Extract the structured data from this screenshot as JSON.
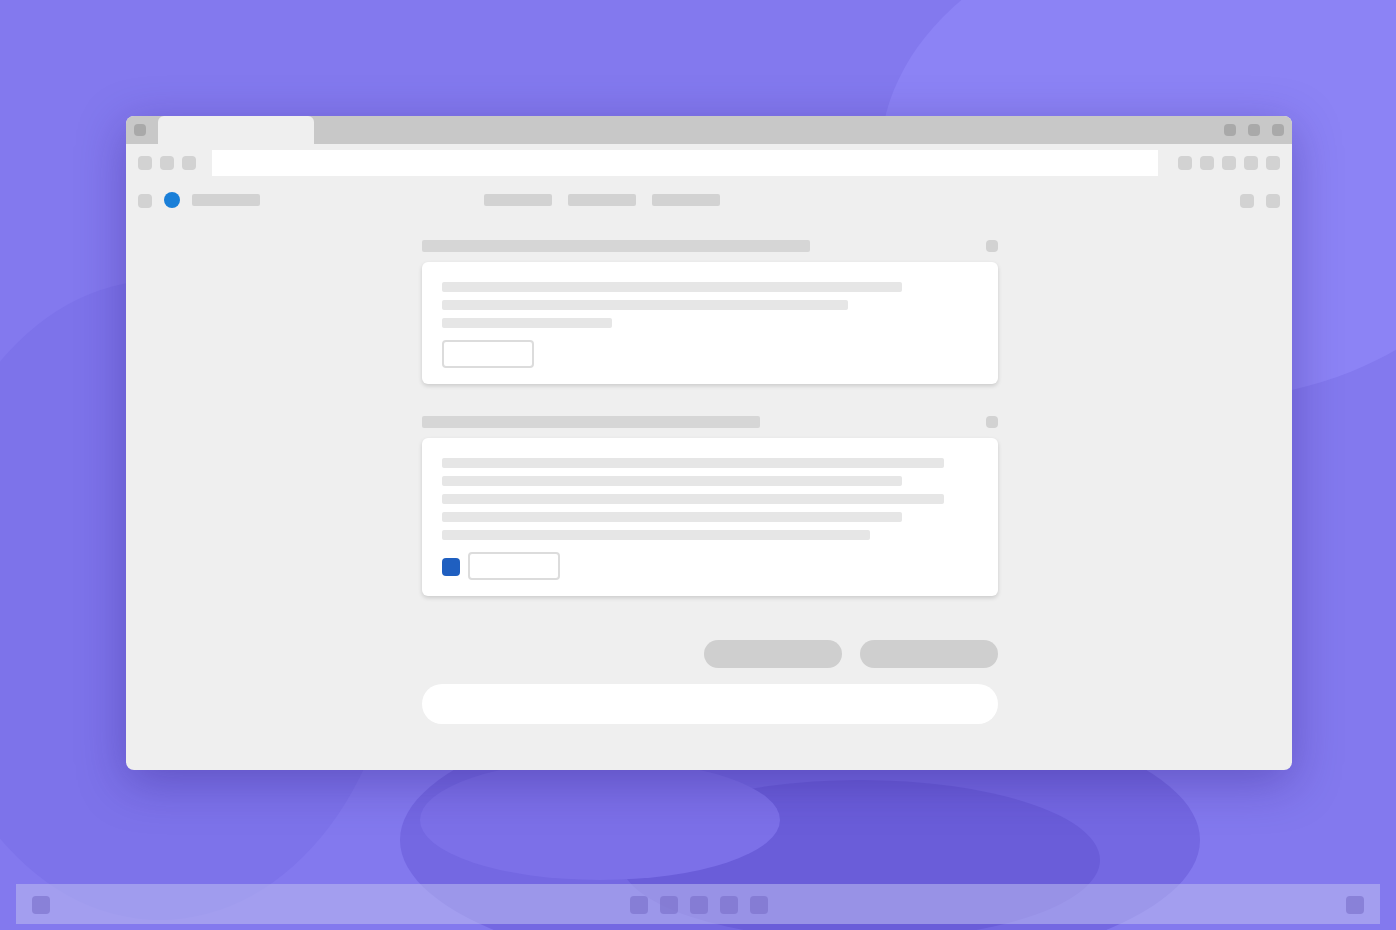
{
  "browser": {
    "tabs": [
      {
        "selected": true
      }
    ]
  },
  "sections": [
    {
      "kind": "button"
    },
    {
      "kind": "file"
    }
  ]
}
